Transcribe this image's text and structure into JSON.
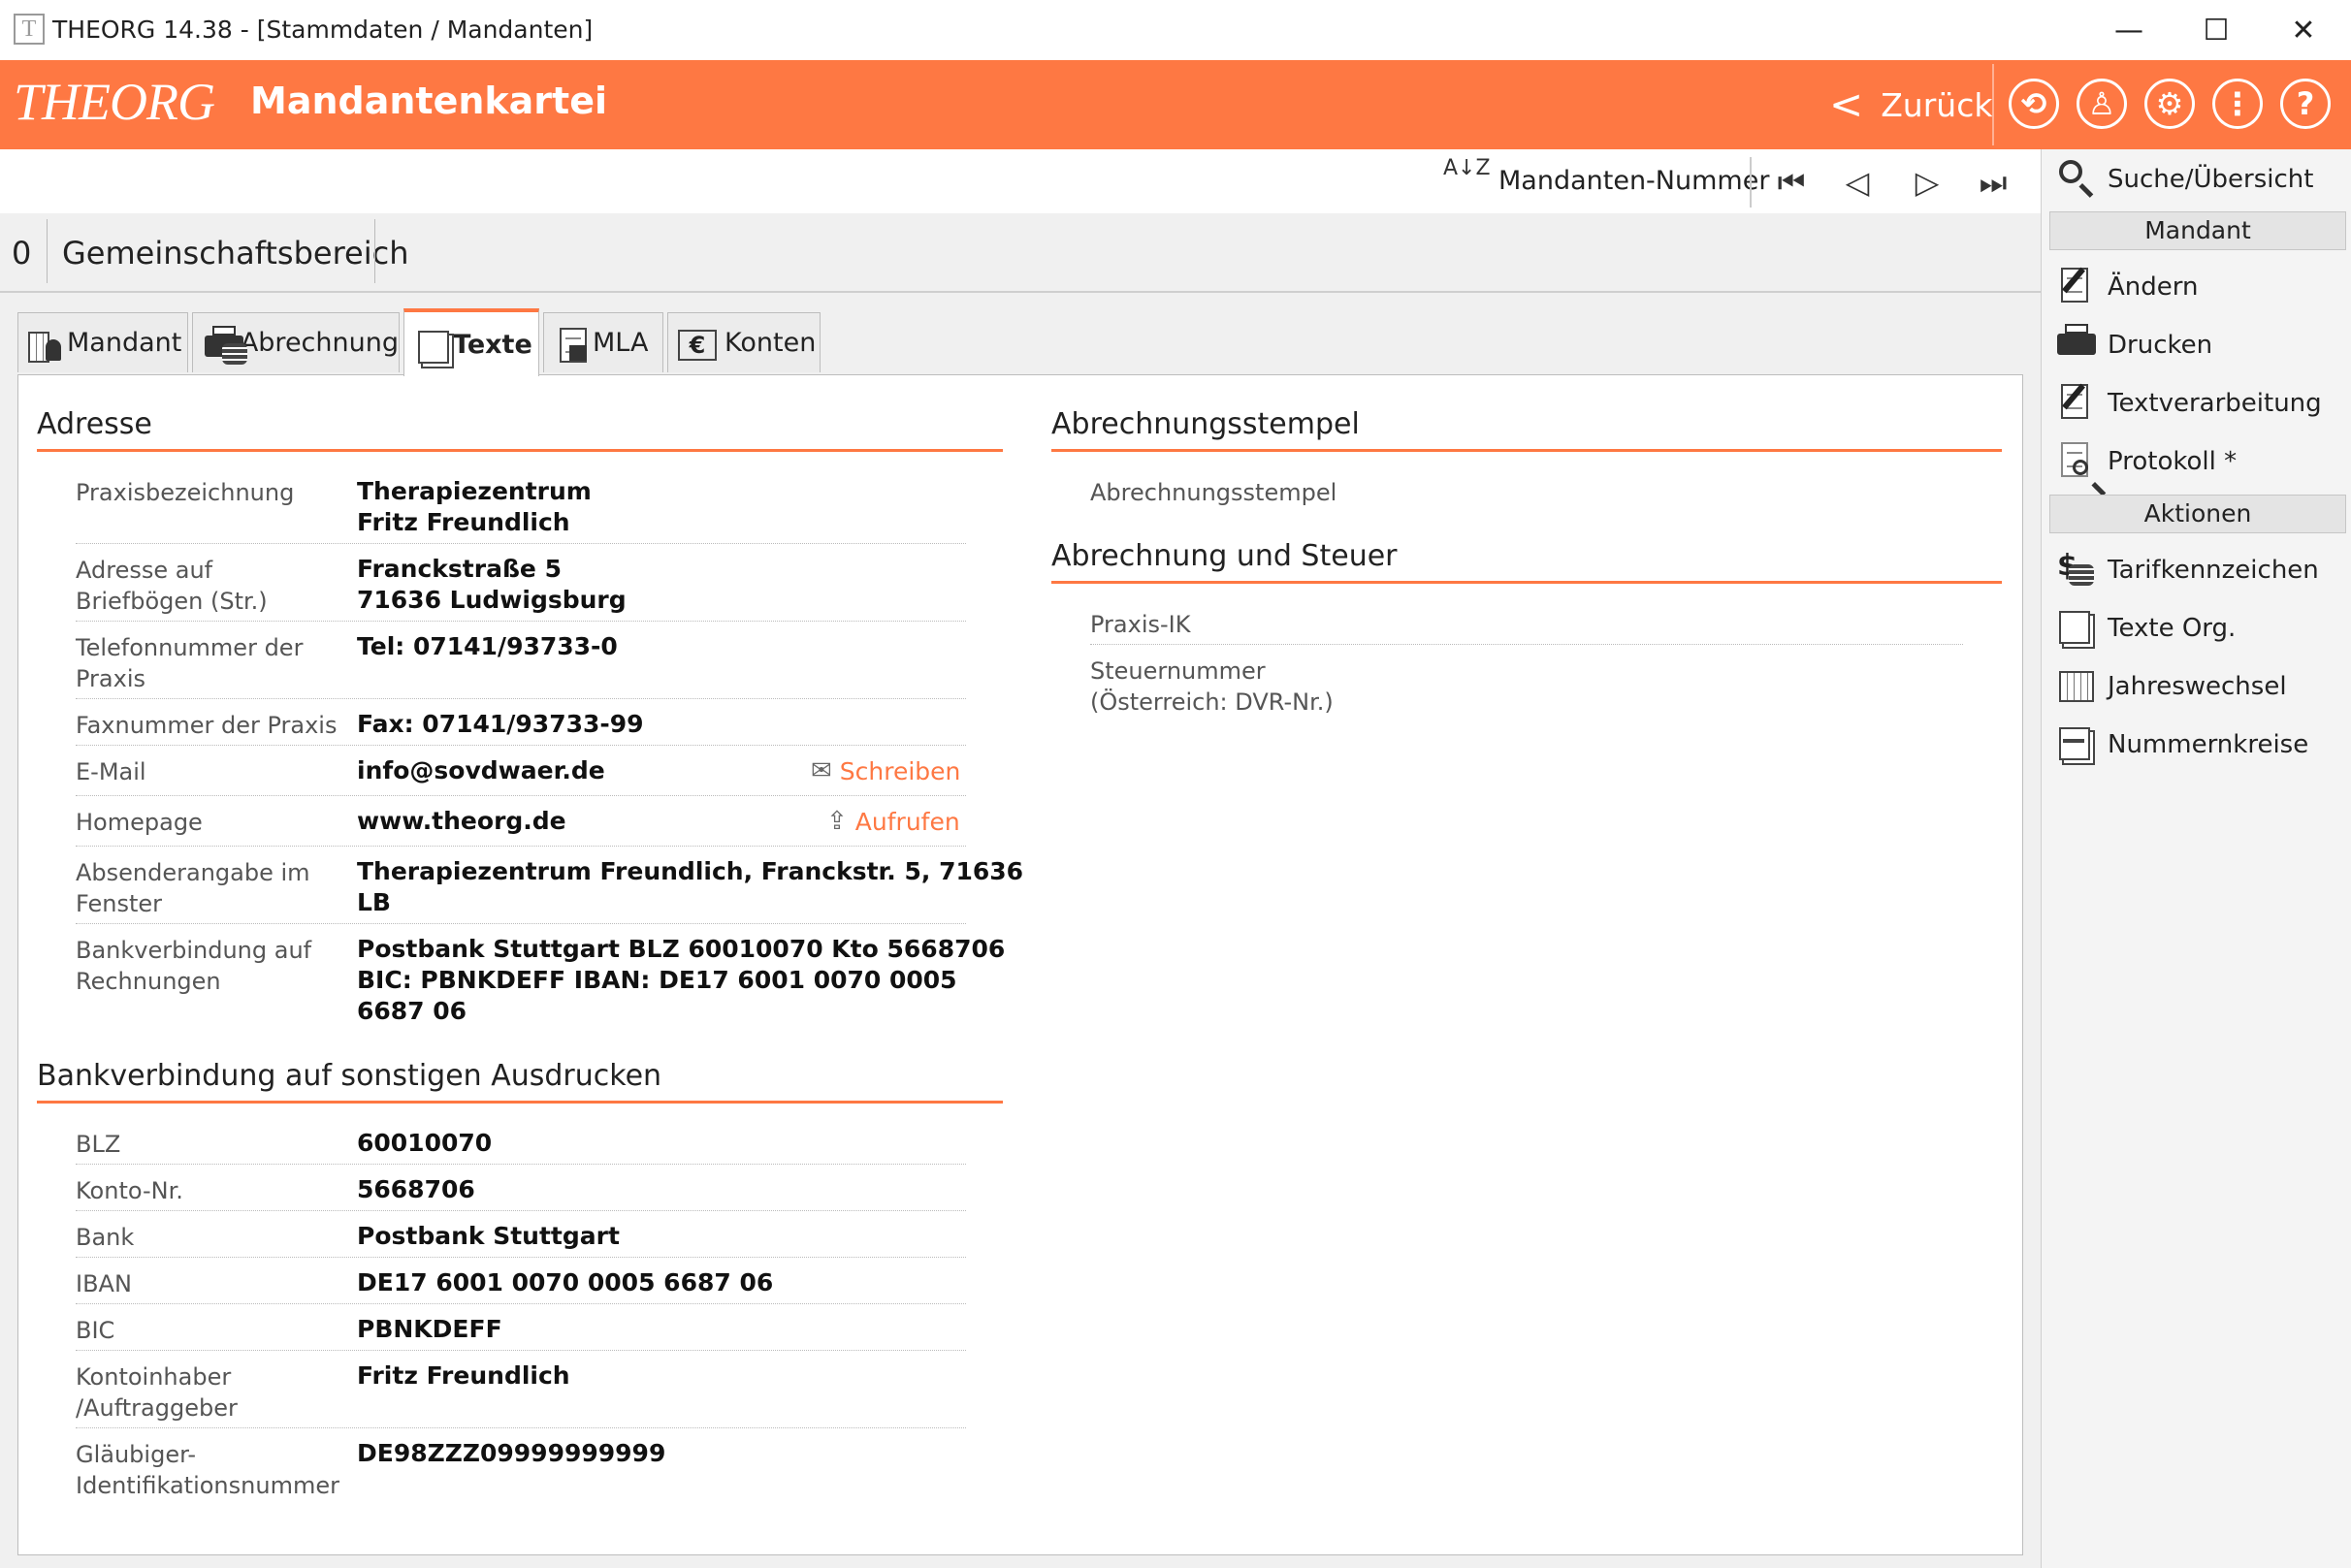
{
  "window": {
    "title": "THEORG 14.38 - [Stammdaten / Mandanten]",
    "app_icon": "T",
    "controls": {
      "minimize": "—",
      "maximize": "☐",
      "close": "✕"
    }
  },
  "header": {
    "logo": "THEORG",
    "title": "Mandantenkartei",
    "back_label": "Zurück",
    "icons": [
      "history-icon",
      "user-support-icon",
      "tools-icon",
      "more-options-icon",
      "help-icon"
    ],
    "icon_glyphs": [
      "⟲",
      "♙",
      "⚙",
      "⋮",
      "?"
    ],
    "accent_color": "#fe7843"
  },
  "toolbar": {
    "sort_glyph": "A↓Z",
    "sort_label": "Mandanten-Nummer",
    "nav_first": "⏮",
    "nav_prev": "◁",
    "nav_next": "▷",
    "nav_last": "⏭"
  },
  "record": {
    "id": "0",
    "name": "Gemeinschaftsbereich"
  },
  "tabs": [
    {
      "label": "Mandant",
      "icon": "building-person-icon",
      "active": false
    },
    {
      "label": "Abrechnung",
      "icon": "printer-coins-icon",
      "active": false
    },
    {
      "label": "Texte",
      "icon": "documents-icon",
      "active": true
    },
    {
      "label": "MLA",
      "icon": "document-save-icon",
      "active": false
    },
    {
      "label": "Konten",
      "icon": "euro-bank-icon",
      "active": false
    }
  ],
  "adresse": {
    "title": "Adresse",
    "rows": [
      {
        "label": "Praxisbezeichnung",
        "value": "Therapiezentrum\nFritz Freundlich"
      },
      {
        "label": "Adresse auf\nBriefbögen (Str.)",
        "value": "Franckstraße 5\n71636 Ludwigsburg"
      },
      {
        "label": "Telefonnummer der\nPraxis",
        "value": "Tel: 07141/93733-0"
      },
      {
        "label": "Faxnummer der Praxis",
        "value": "Fax: 07141/93733-99"
      },
      {
        "label": "E-Mail",
        "value": "info@sovdwaer.de",
        "action": "Schreiben",
        "action_icon": "envelope-icon"
      },
      {
        "label": "Homepage",
        "value": "www.theorg.de",
        "action": "Aufrufen",
        "action_icon": "open-link-icon"
      },
      {
        "label": "Absenderangabe im\nFenster",
        "value": "Therapiezentrum Freundlich, Franckstr. 5, 71636\nLB"
      },
      {
        "label": "Bankverbindung auf\nRechnungen",
        "value": "Postbank Stuttgart BLZ 60010070 Kto 5668706\nBIC: PBNKDEFF IBAN: DE17 6001 0070 0005\n6687 06"
      }
    ]
  },
  "bank": {
    "title": "Bankverbindung auf sonstigen Ausdrucken",
    "rows": [
      {
        "label": "BLZ",
        "value": "60010070"
      },
      {
        "label": "Konto-Nr.",
        "value": "5668706"
      },
      {
        "label": "Bank",
        "value": "Postbank Stuttgart"
      },
      {
        "label": "IBAN",
        "value": "DE17 6001 0070 0005 6687 06"
      },
      {
        "label": "BIC",
        "value": "PBNKDEFF"
      },
      {
        "label": "Kontoinhaber\n/Auftraggeber",
        "value": "Fritz Freundlich"
      },
      {
        "label": "Gläubiger-\nIdentifikationsnummer",
        "value": "DE98ZZZ09999999999"
      }
    ]
  },
  "stempel": {
    "title": "Abrechnungsstempel",
    "label": "Abrechnungsstempel"
  },
  "steuer": {
    "title": "Abrechnung und Steuer",
    "rows": [
      {
        "label": "Praxis-IK"
      },
      {
        "label": "Steuernummer\n(Österreich: DVR-Nr.)"
      }
    ]
  },
  "sidebar": {
    "search_label": "Suche/Übersicht",
    "group_mandant": "Mandant",
    "mandant_items": [
      {
        "label": "Ändern",
        "icon": "edit-document-icon"
      },
      {
        "label": "Drucken",
        "icon": "printer-icon"
      },
      {
        "label": "Textverarbeitung",
        "icon": "text-processing-icon"
      },
      {
        "label": "Protokoll *",
        "icon": "protocol-search-icon"
      }
    ],
    "group_aktionen": "Aktionen",
    "aktionen_items": [
      {
        "label": "Tarifkennzeichen",
        "icon": "tariff-coins-icon"
      },
      {
        "label": "Texte Org.",
        "icon": "documents-stack-icon"
      },
      {
        "label": "Jahreswechsel",
        "icon": "calendar-icon"
      },
      {
        "label": "Nummernkreise",
        "icon": "number-range-icon"
      }
    ]
  }
}
